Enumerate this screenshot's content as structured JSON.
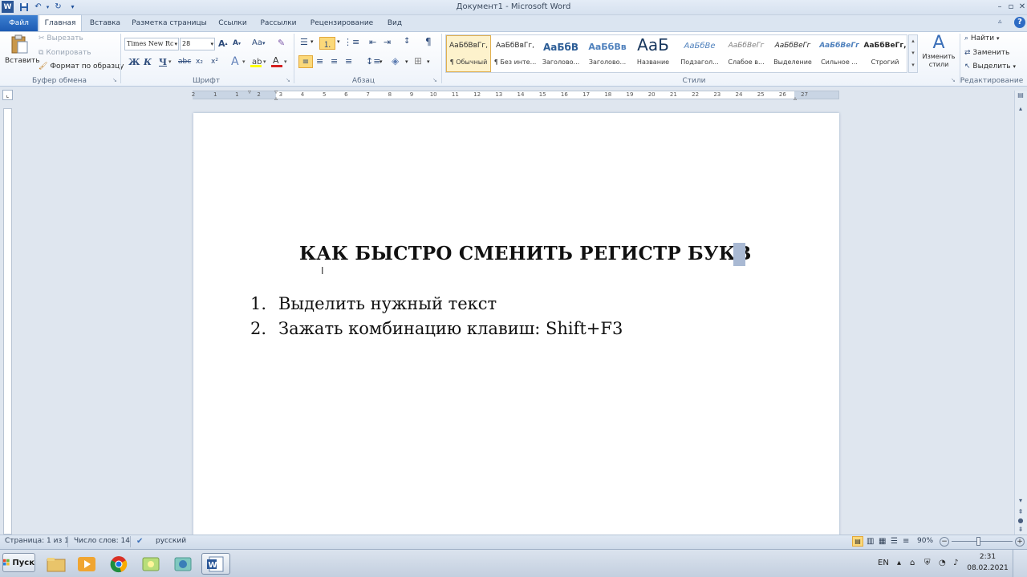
{
  "window": {
    "title": "Документ1 - Microsoft Word"
  },
  "tabs": [
    {
      "label": "Файл"
    },
    {
      "label": "Главная"
    },
    {
      "label": "Вставка"
    },
    {
      "label": "Разметка страницы"
    },
    {
      "label": "Ссылки"
    },
    {
      "label": "Рассылки"
    },
    {
      "label": "Рецензирование"
    },
    {
      "label": "Вид"
    }
  ],
  "clipboard": {
    "paste": "Вставить",
    "cut": "Вырезать",
    "copy": "Копировать",
    "format_painter": "Формат по образцу",
    "group_label": "Буфер обмена"
  },
  "font": {
    "name": "Times New Rc",
    "size": "28",
    "change_case": "Aa",
    "group_label": "Шрифт",
    "bold": "Ж",
    "italic": "К",
    "underline": "Ч",
    "strikethrough": "abc",
    "subscript": "x₂",
    "superscript": "x²"
  },
  "paragraph": {
    "group_label": "Абзац"
  },
  "styles": {
    "group_label": "Стили",
    "items": [
      {
        "preview": "АаБбВвГг,",
        "name": "¶ Обычный"
      },
      {
        "preview": "АаБбВвГг,",
        "name": "¶ Без инте..."
      },
      {
        "preview": "АаБбВ",
        "name": "Заголово..."
      },
      {
        "preview": "АаБбВв",
        "name": "Заголово..."
      },
      {
        "preview": "АаБ",
        "name": "Название"
      },
      {
        "preview": "АаБбВе",
        "name": "Подзагол..."
      },
      {
        "preview": "АаБбВеГг",
        "name": "Слабое в..."
      },
      {
        "preview": "АаБбВеГг",
        "name": "Выделение"
      },
      {
        "preview": "АаБбВеГг",
        "name": "Сильное ..."
      },
      {
        "preview": "АаБбВеГг,",
        "name": "Строгий"
      }
    ],
    "change_styles": "Изменить стили"
  },
  "editing": {
    "find": "Найти",
    "replace": "Заменить",
    "select": "Выделить",
    "group_label": "Редактирование"
  },
  "ruler": {
    "numbers": [
      "2",
      "1",
      "1",
      "2",
      "3",
      "4",
      "5",
      "6",
      "7",
      "8",
      "9",
      "10",
      "11",
      "12",
      "13",
      "14",
      "15",
      "16",
      "17",
      "18",
      "19",
      "20",
      "21",
      "22",
      "23",
      "24",
      "25",
      "26",
      "27"
    ]
  },
  "document": {
    "title": "КАК БЫСТРО СМЕНИТЬ РЕГИСТР БУКВ",
    "list": [
      {
        "num": "1.",
        "text": "Выделить нужный текст"
      },
      {
        "num": "2.",
        "text": "Зажать комбинацию клавиш: Shift+F3"
      }
    ]
  },
  "status": {
    "page": "Страница: 1 из 1",
    "words": "Число слов: 14",
    "language": "русский",
    "zoom": "90%"
  },
  "taskbar": {
    "start": "Пуск",
    "lang": "EN",
    "time": "2:31",
    "date": "08.02.2021"
  },
  "colors": {
    "file_tab": "#2b6cc4",
    "accent_selection": "#fbd97a",
    "highlight": "#a9b9d3"
  }
}
